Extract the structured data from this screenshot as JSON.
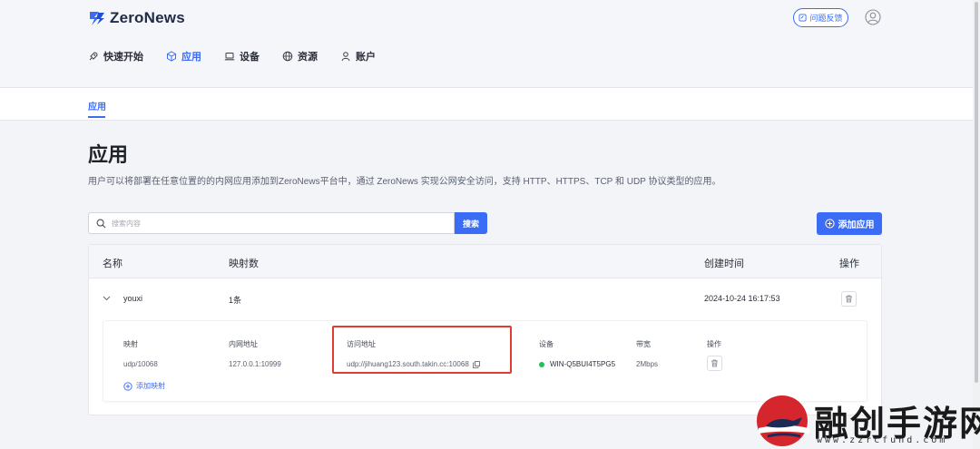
{
  "app": {
    "name": "ZeroNews"
  },
  "header": {
    "feedback_label": "问题反馈"
  },
  "nav": {
    "items": [
      {
        "label": "快速开始",
        "icon": "rocket-icon"
      },
      {
        "label": "应用",
        "icon": "cube-icon",
        "active": true
      },
      {
        "label": "设备",
        "icon": "laptop-icon"
      },
      {
        "label": "资源",
        "icon": "globe-icon"
      },
      {
        "label": "账户",
        "icon": "user-icon"
      }
    ]
  },
  "subtabs": {
    "active": "应用"
  },
  "page": {
    "title": "应用",
    "description": "用户可以将部署在任意位置的的内网应用添加到ZeroNews平台中，通过 ZeroNews 实现公网安全访问，支持 HTTP、HTTPS、TCP 和 UDP 协议类型的应用。"
  },
  "search": {
    "placeholder": "搜索内容",
    "button_label": "搜索"
  },
  "add_app_label": "添加应用",
  "table": {
    "headers": {
      "name": "名称",
      "mappings": "映射数",
      "created": "创建时间",
      "actions": "操作"
    },
    "rows": [
      {
        "name": "youxi",
        "mappings": "1条",
        "created": "2024-10-24 16:17:53"
      }
    ]
  },
  "detail": {
    "headers": {
      "mapping": "映射",
      "internal_address": "内网地址",
      "access_address": "访问地址",
      "device": "设备",
      "bandwidth": "带宽",
      "actions": "操作"
    },
    "rows": [
      {
        "mapping": "udp/10068",
        "internal_address": "127.0.0.1:10999",
        "access_address": "udp://jihuang123.south.takin.cc:10068",
        "device": "WIN-Q5BUI4T5PG5",
        "device_status": "online",
        "bandwidth": "2Mbps"
      }
    ],
    "add_mapping_label": "添加映射"
  },
  "watermark": {
    "title": "融创手游网",
    "url": "www.zzrcfund.com"
  },
  "colors": {
    "accent": "#3b6cf6",
    "highlight": "#e23b33",
    "online": "#20c05c"
  }
}
